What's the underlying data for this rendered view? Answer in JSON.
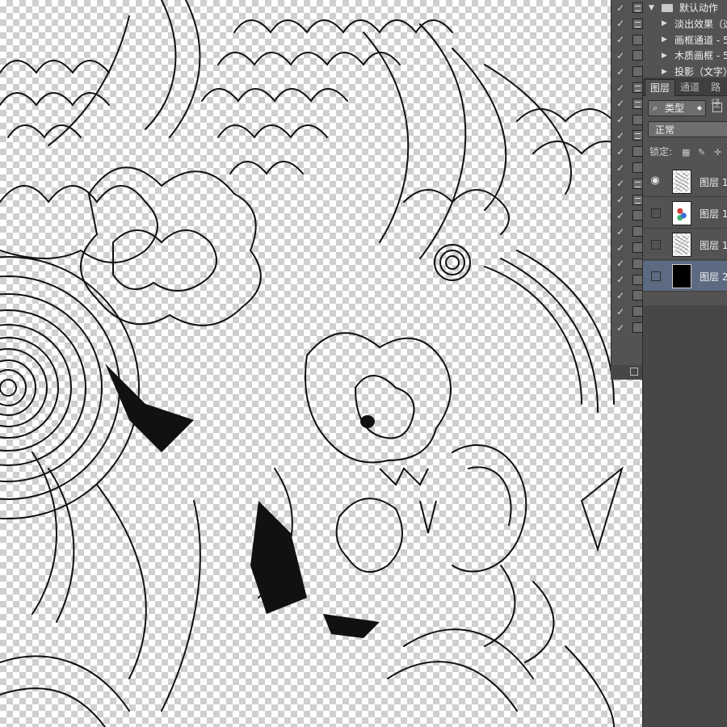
{
  "actions_panel": {
    "rows": [
      {
        "checked": true,
        "dialog": true,
        "label": "默认动作",
        "kind": "set"
      },
      {
        "checked": true,
        "dialog": true,
        "label": "淡出效果（选",
        "kind": "action"
      },
      {
        "checked": true,
        "dialog": false,
        "label": "画框通道 - 5",
        "kind": "action"
      },
      {
        "checked": true,
        "dialog": false,
        "label": "木质画框 - 5",
        "kind": "action"
      },
      {
        "checked": true,
        "dialog": false,
        "label": "投影（文字）",
        "kind": "action"
      },
      {
        "checked": true,
        "dialog": true,
        "label": "",
        "kind": "blank"
      },
      {
        "checked": true,
        "dialog": true,
        "label": "",
        "kind": "blank"
      },
      {
        "checked": true,
        "dialog": false,
        "label": "",
        "kind": "blank"
      },
      {
        "checked": true,
        "dialog": true,
        "label": "",
        "kind": "blank"
      },
      {
        "checked": true,
        "dialog": false,
        "label": "",
        "kind": "blank"
      },
      {
        "checked": true,
        "dialog": false,
        "label": "",
        "kind": "blank"
      },
      {
        "checked": true,
        "dialog": true,
        "label": "",
        "kind": "blank"
      },
      {
        "checked": true,
        "dialog": true,
        "label": "",
        "kind": "blank"
      },
      {
        "checked": true,
        "dialog": false,
        "label": "",
        "kind": "blank"
      },
      {
        "checked": true,
        "dialog": false,
        "label": "",
        "kind": "blank"
      },
      {
        "checked": true,
        "dialog": false,
        "label": "",
        "kind": "blank"
      },
      {
        "checked": true,
        "dialog": false,
        "label": "",
        "kind": "blank"
      },
      {
        "checked": true,
        "dialog": false,
        "label": "",
        "kind": "blank"
      },
      {
        "checked": true,
        "dialog": false,
        "label": "",
        "kind": "blank"
      },
      {
        "checked": true,
        "dialog": false,
        "label": "",
        "kind": "blank"
      },
      {
        "checked": true,
        "dialog": false,
        "label": "",
        "kind": "blank"
      }
    ]
  },
  "layers_panel": {
    "tabs": [
      "图层",
      "通道",
      "路径"
    ],
    "filter": {
      "icon": "search-icon",
      "label": "类型"
    },
    "blend_mode": "正常",
    "lock_label": "锁定:",
    "layers": [
      {
        "name": "图层 1",
        "visible": true,
        "thumb": "lines",
        "selected": false
      },
      {
        "name": "图层 1",
        "visible": false,
        "thumb": "color",
        "selected": false
      },
      {
        "name": "图层 1",
        "visible": false,
        "thumb": "lines",
        "selected": false
      },
      {
        "name": "图层 2",
        "visible": false,
        "thumb": "black",
        "selected": true
      }
    ]
  },
  "colors": {
    "panel_bg": "#535353",
    "panel_dark": "#3f3f3f",
    "selection": "#5d6b82",
    "line_art": "#111111"
  }
}
